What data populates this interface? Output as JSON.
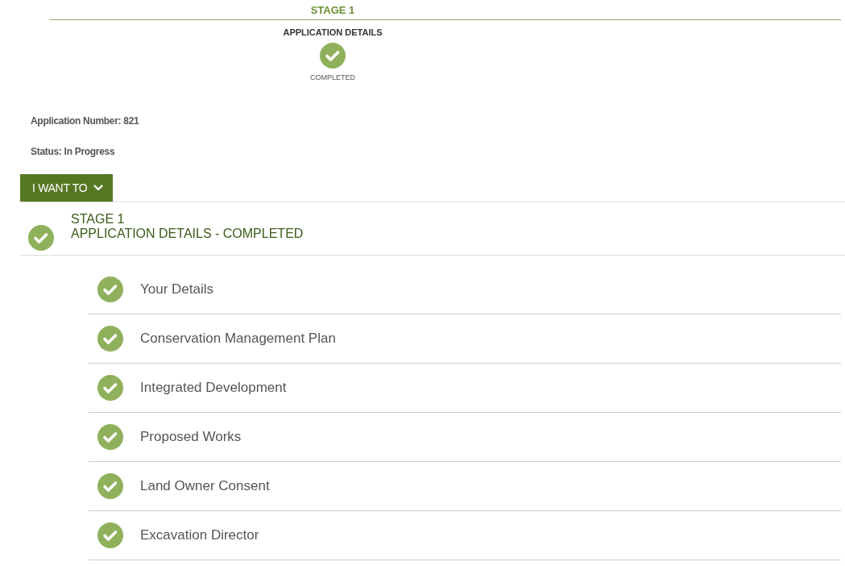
{
  "progress": {
    "stage_label": "STAGE 1",
    "steps": [
      {
        "title": "APPLICATION DETAILS",
        "status": "COMPLETED",
        "completed": true
      }
    ]
  },
  "application_number": "Application Number: 821",
  "status": "Status: In Progress",
  "menu_button": {
    "label": "I WANT TO",
    "expanded": false
  },
  "stage": {
    "title": "STAGE 1",
    "subtitle": "APPLICATION DETAILS - COMPLETED",
    "completed": true
  },
  "sections": [
    {
      "label": "Your Details",
      "completed": true
    },
    {
      "label": "Conservation Management Plan",
      "completed": true
    },
    {
      "label": "Integrated Development",
      "completed": true
    },
    {
      "label": "Proposed Works",
      "completed": true
    },
    {
      "label": "Land Owner Consent",
      "completed": true
    },
    {
      "label": "Excavation Director",
      "completed": true
    }
  ]
}
